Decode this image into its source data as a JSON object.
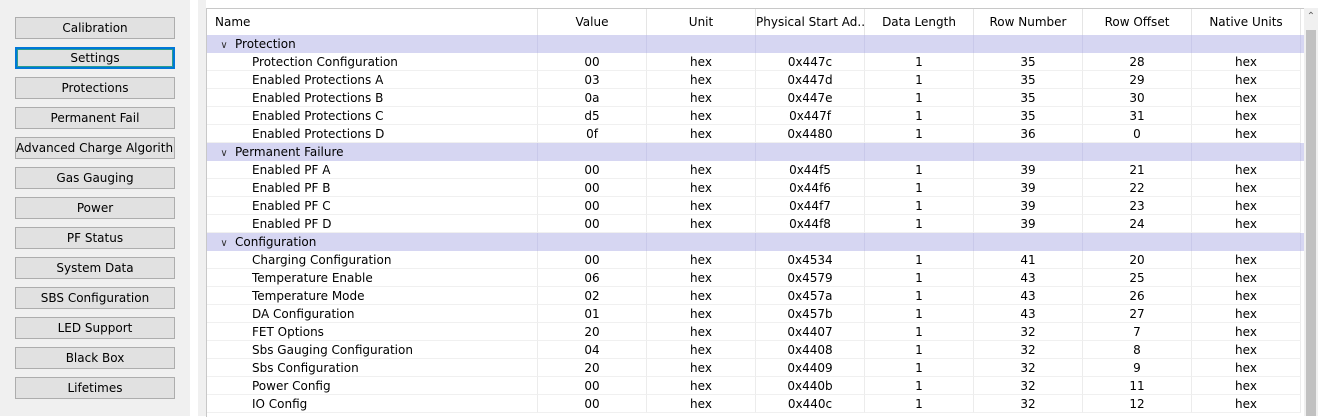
{
  "sidebar": {
    "buttons": [
      {
        "label": "Calibration"
      },
      {
        "label": "Settings"
      },
      {
        "label": "Protections"
      },
      {
        "label": "Permanent Fail"
      },
      {
        "label": "Advanced Charge Algorithm"
      },
      {
        "label": "Gas Gauging"
      },
      {
        "label": "Power"
      },
      {
        "label": "PF Status"
      },
      {
        "label": "System Data"
      },
      {
        "label": "SBS Configuration"
      },
      {
        "label": "LED Support"
      },
      {
        "label": "Black Box"
      },
      {
        "label": "Lifetimes"
      }
    ],
    "active_index": 1
  },
  "table": {
    "columns": [
      "Name",
      "Value",
      "Unit",
      "Physical Start Ad...",
      "Data Length",
      "Row Number",
      "Row Offset",
      "Native Units"
    ],
    "groups": [
      {
        "title": "Protection",
        "rows": [
          [
            "Protection Configuration",
            "00",
            "hex",
            "0x447c",
            "1",
            "35",
            "28",
            "hex"
          ],
          [
            "Enabled Protections A",
            "03",
            "hex",
            "0x447d",
            "1",
            "35",
            "29",
            "hex"
          ],
          [
            "Enabled Protections B",
            "0a",
            "hex",
            "0x447e",
            "1",
            "35",
            "30",
            "hex"
          ],
          [
            "Enabled Protections C",
            "d5",
            "hex",
            "0x447f",
            "1",
            "35",
            "31",
            "hex"
          ],
          [
            "Enabled Protections D",
            "0f",
            "hex",
            "0x4480",
            "1",
            "36",
            "0",
            "hex"
          ]
        ]
      },
      {
        "title": "Permanent Failure",
        "rows": [
          [
            "Enabled PF A",
            "00",
            "hex",
            "0x44f5",
            "1",
            "39",
            "21",
            "hex"
          ],
          [
            "Enabled PF B",
            "00",
            "hex",
            "0x44f6",
            "1",
            "39",
            "22",
            "hex"
          ],
          [
            "Enabled PF C",
            "00",
            "hex",
            "0x44f7",
            "1",
            "39",
            "23",
            "hex"
          ],
          [
            "Enabled PF D",
            "00",
            "hex",
            "0x44f8",
            "1",
            "39",
            "24",
            "hex"
          ]
        ]
      },
      {
        "title": "Configuration",
        "rows": [
          [
            "Charging Configuration",
            "00",
            "hex",
            "0x4534",
            "1",
            "41",
            "20",
            "hex"
          ],
          [
            "Temperature Enable",
            "06",
            "hex",
            "0x4579",
            "1",
            "43",
            "25",
            "hex"
          ],
          [
            "Temperature Mode",
            "02",
            "hex",
            "0x457a",
            "1",
            "43",
            "26",
            "hex"
          ],
          [
            "DA Configuration",
            "01",
            "hex",
            "0x457b",
            "1",
            "43",
            "27",
            "hex"
          ],
          [
            "FET Options",
            "20",
            "hex",
            "0x4407",
            "1",
            "32",
            "7",
            "hex"
          ],
          [
            "Sbs Gauging Configuration",
            "04",
            "hex",
            "0x4408",
            "1",
            "32",
            "8",
            "hex"
          ],
          [
            "Sbs Configuration",
            "20",
            "hex",
            "0x4409",
            "1",
            "32",
            "9",
            "hex"
          ],
          [
            "Power Config",
            "00",
            "hex",
            "0x440b",
            "1",
            "32",
            "11",
            "hex"
          ],
          [
            "IO Config",
            "00",
            "hex",
            "0x440c",
            "1",
            "32",
            "12",
            "hex"
          ]
        ]
      }
    ]
  },
  "icons": {
    "group_toggle": "chevron-down-icon",
    "scroll_up": "scroll-up-arrow-icon"
  },
  "colors": {
    "group_band": "#d6d6f2",
    "active_focus": "#0078d7",
    "button_face": "#e1e1e1"
  }
}
